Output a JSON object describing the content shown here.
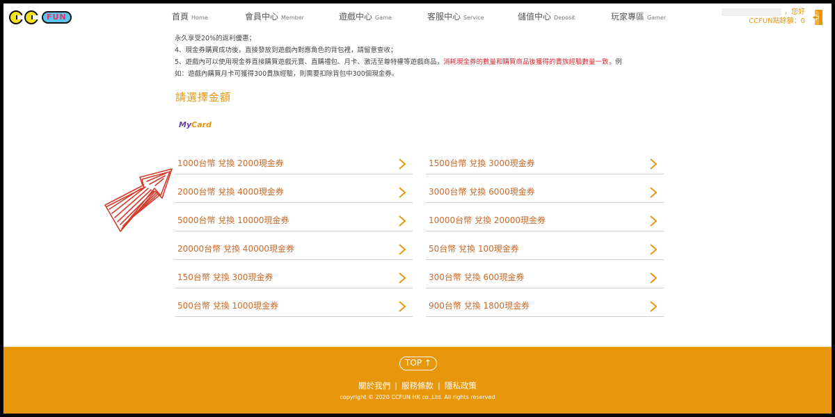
{
  "header": {
    "logo_text": "FUN",
    "nav": [
      {
        "zh": "首頁",
        "en": "Home"
      },
      {
        "zh": "會員中心",
        "en": "Member"
      },
      {
        "zh": "遊戲中心",
        "en": "Game"
      },
      {
        "zh": "客服中心",
        "en": "Service"
      },
      {
        "zh": "儲值中心",
        "en": "Deposit"
      },
      {
        "zh": "玩家專區",
        "en": "Gamer"
      }
    ],
    "greeting": "，您好",
    "points_label": "CCFUN點餘額：0"
  },
  "notes": {
    "line1": "永久享受20%的返利優惠；",
    "line2": "4、現金券購買成功後，直接發放到遊戲內對應角色的背包裡，請留意查收；",
    "line3_a": "5、遊戲內可以使用現金券直接購買遊戲元寶、直購禮包、月卡、激活至尊特權等遊戲商品，",
    "line3_red": "消耗現金券的數量和購買商品後獲得的貴族經驗數量一致，",
    "line3_b": "例",
    "line4": "如：遊戲內購買月卡可獲得300貴族經驗，則需要扣除背包中300個現金券。"
  },
  "section_title": "請選擇金額",
  "payment_logo": {
    "my": "My",
    "card": "Card"
  },
  "options_left": [
    "1000台幣 兌換 2000現金券",
    "2000台幣 兌換 4000現金券",
    "5000台幣 兌換 10000現金券",
    "20000台幣 兌換 40000現金券",
    "150台幣 兌換 300現金券",
    "500台幣 兌換 1000現金券"
  ],
  "options_right": [
    "1500台幣 兌換 3000現金券",
    "3000台幣 兌換 6000現金券",
    "10000台幣 兌換 20000現金券",
    "50台幣 兌換 100現金券",
    "300台幣 兌換 600現金券",
    "900台幣 兌換 1800現金券"
  ],
  "footer": {
    "top_label": "TOP ↑",
    "links": [
      "關於我們",
      "服務條款",
      "隱私政策"
    ],
    "copyright": "copyright © 2020 CCFUN HK co.,Ltd. All rights reserved"
  },
  "colors": {
    "accent": "#e8960c",
    "option_text": "#c96a2a",
    "warning": "#d9272e",
    "annotation_arrow": "#d33a2c"
  },
  "icons": {
    "option_arrow": "chevron-right-icon",
    "logout": "logout-door-icon",
    "annotation": "hand-drawn-arrow-icon"
  }
}
